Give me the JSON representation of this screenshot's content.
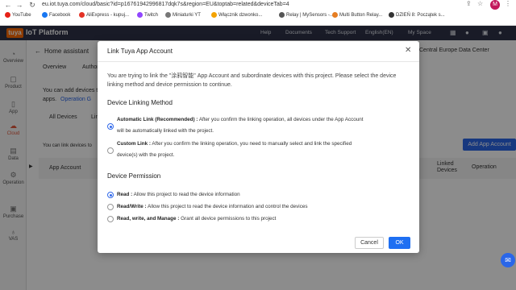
{
  "browser": {
    "url": "eu.iot.tuya.com/cloud/basic?id=p1676194299681​7dqk7s&region=EU&toptab=related&deviceTab=4",
    "avatar": "M",
    "bookmarks": [
      "YouTube",
      "Facebook",
      "AliExpress - kupuj...",
      "Twitch",
      "Miniaturki YT",
      "Włącznik dzwonko...",
      "Relay | MySensors -...",
      "Multi Button Relay...",
      "DZIEŃ 8: Początek s..."
    ]
  },
  "topbar": {
    "logo": "tuya",
    "title": "IoT Platform",
    "nav": [
      "Help",
      "Documents",
      "Tech Support",
      "English(EN)",
      "My Space"
    ]
  },
  "sidebar": {
    "items": [
      "Overview",
      "Product",
      "App",
      "Cloud",
      "Data",
      "Operation",
      "Purchase",
      "VAS"
    ]
  },
  "page": {
    "breadcrumb": "Home assistant",
    "tabs": [
      "Overview",
      "Author"
    ],
    "region": "Central Europe Data Center",
    "info_text": "You can add devices t",
    "info_text2": "apps.",
    "info_link": "Operation G",
    "subtab_all": "All Devices",
    "subtab_link": "Lin",
    "link_hint": "You can link devices to",
    "add_button": "Add App Account",
    "col_app_account": "App Account",
    "col_linked": "Linked",
    "col_devices": "Devices",
    "col_operation": "Operation"
  },
  "modal": {
    "title": "Link Tuya App Account",
    "intro": "You are trying to link the \"涂鸦智能\" App Account and subordinate devices with this project. Please select the device linking method and device permission to continue.",
    "method_heading": "Device Linking Method",
    "method_options": [
      {
        "label": "Automatic Link (Recommended) :",
        "desc1": " After you confirm the linking operation, all devices under the App Account",
        "desc2": "will be automatically linked with the project.",
        "checked": true
      },
      {
        "label": "Custom Link :",
        "desc1": " After you confirm the linking operation, you need to manually select and link the specified",
        "desc2": "device(s) with the project.",
        "checked": false
      }
    ],
    "permission_heading": "Device Permission",
    "permission_options": [
      {
        "label": "Read :",
        "desc": " Allow this project to read the device information",
        "checked": true
      },
      {
        "label": "Read/Write :",
        "desc": " Allow this project to read the device information and control the devices",
        "checked": false
      },
      {
        "label": "Read, write, and Manage :",
        "desc": " Grant all device permissions to this project",
        "checked": false
      }
    ],
    "cancel": "Cancel",
    "ok": "OK"
  },
  "colors": {
    "accent": "#1e6ff2",
    "brand": "#ff6a00",
    "topbar": "#2e3247"
  },
  "icons": [
    "back-icon",
    "forward-icon",
    "reload-icon",
    "close-icon",
    "chat-icon"
  ]
}
